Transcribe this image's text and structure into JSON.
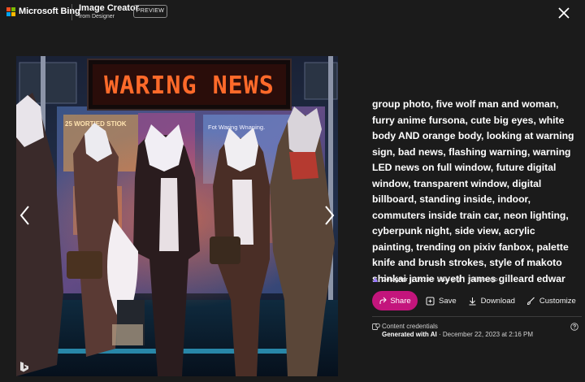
{
  "colors": {
    "background": "#1b1b1b",
    "share_accent": "#c3157c",
    "logo": [
      "#f25022",
      "#7fba00",
      "#00a4ef",
      "#ffb900"
    ]
  },
  "header": {
    "brand": "Microsoft Bing",
    "product_title": "Image Creator",
    "product_subtitle": "from Designer",
    "badge": "PREVIEW",
    "close_icon": "close-icon"
  },
  "image": {
    "sign_text": "WARING NEWS",
    "screen_left_text": "25 WORTIED STIOK",
    "screen_right_text": "Fot Waring Wnaning.",
    "prev_icon": "chevron-left-icon",
    "next_icon": "chevron-right-icon",
    "watermark_icon": "bing-watermark-icon"
  },
  "details": {
    "prompt": "group photo, five wolf man and woman, furry anime fursona, cute big eyes, white body AND orange body, looking at warning sign, bad news, flashing warning, warning LED news on full window, future digital window, transparent window, digital billboard, standing inside, indoor, commuters inside train car, neon lighting, cyberpunk night, side view, acrylic painting, trending on pixiv fanbox, palette knife and brush strokes, style of makoto shinkai jamie wyeth james gilleard edwar",
    "creator": "Designer",
    "separator": "|",
    "dimensions": "1024 × 1024 jpg",
    "age": "2 days ago"
  },
  "actions": {
    "share": "Share",
    "save": "Save",
    "download": "Download",
    "customize": "Customize"
  },
  "credentials": {
    "title": "Content credentials",
    "generated_label": "Generated with AI",
    "date": "· December 22, 2023 at 2:16 PM"
  }
}
